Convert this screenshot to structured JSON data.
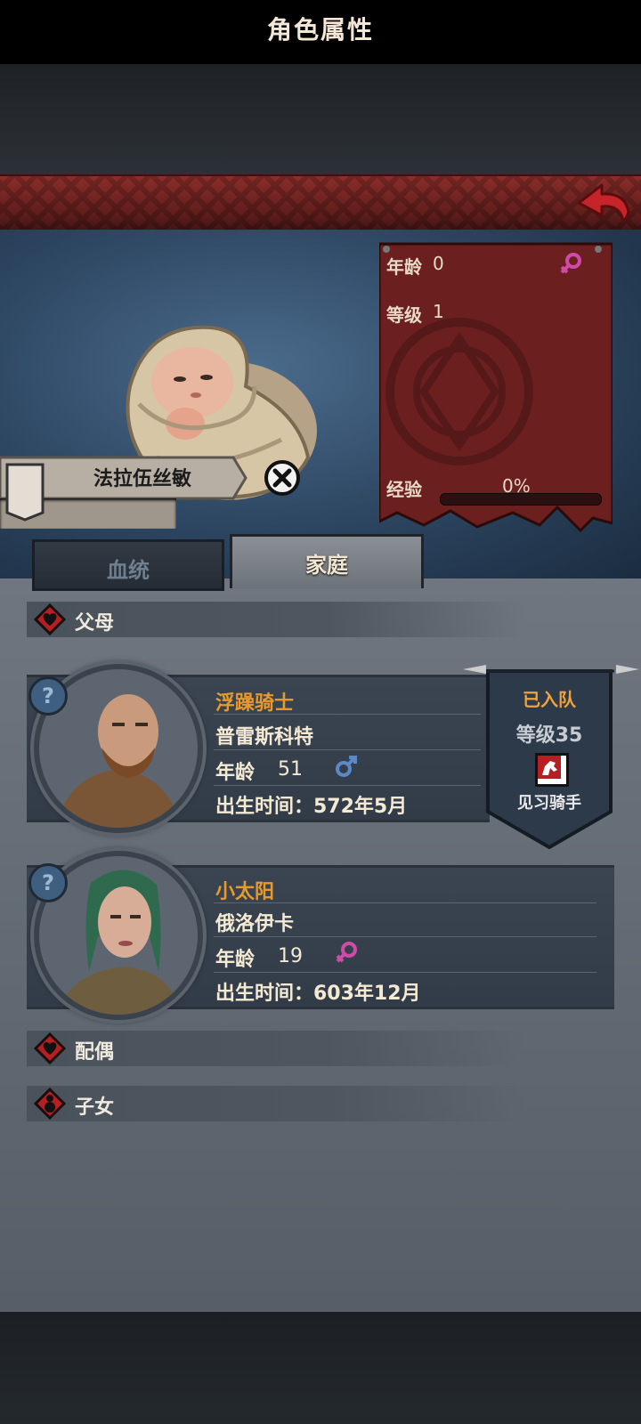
{
  "header": {
    "title": "角色属性"
  },
  "character": {
    "name": "法拉伍丝敏",
    "stats": {
      "age_label": "年龄",
      "age_value": "0",
      "level_label": "等级",
      "level_value": "1",
      "exp_label": "经验",
      "exp_value": "0%",
      "exp_fraction": 0
    },
    "gender": "female"
  },
  "tabs": [
    {
      "label": "血统",
      "active": false
    },
    {
      "label": "家庭",
      "active": true
    }
  ],
  "sections": {
    "parents": "父母",
    "spouse": "配偶",
    "children": "子女"
  },
  "parents": [
    {
      "title": "浮躁骑士",
      "name": "普雷斯科特",
      "age_label": "年龄",
      "age": "51",
      "gender": "male",
      "birth": "出生时间：572年5月",
      "squad": {
        "status": "已入队",
        "level_text": "等级35",
        "role": "见习骑手"
      }
    },
    {
      "title": "小太阳",
      "name": "俄洛伊卡",
      "age_label": "年龄",
      "age": "19",
      "gender": "female",
      "birth": "出生时间：603年12月"
    }
  ],
  "colors": {
    "accent_red": "#b51f22",
    "title_orange": "#e69a2e",
    "female": "#d04aa8",
    "male": "#5a88c8"
  },
  "icons": [
    "back-arrow-icon",
    "close-icon",
    "female-icon",
    "male-icon",
    "heart-icon",
    "child-icon",
    "question-icon",
    "horse-icon",
    "flag-icon"
  ]
}
